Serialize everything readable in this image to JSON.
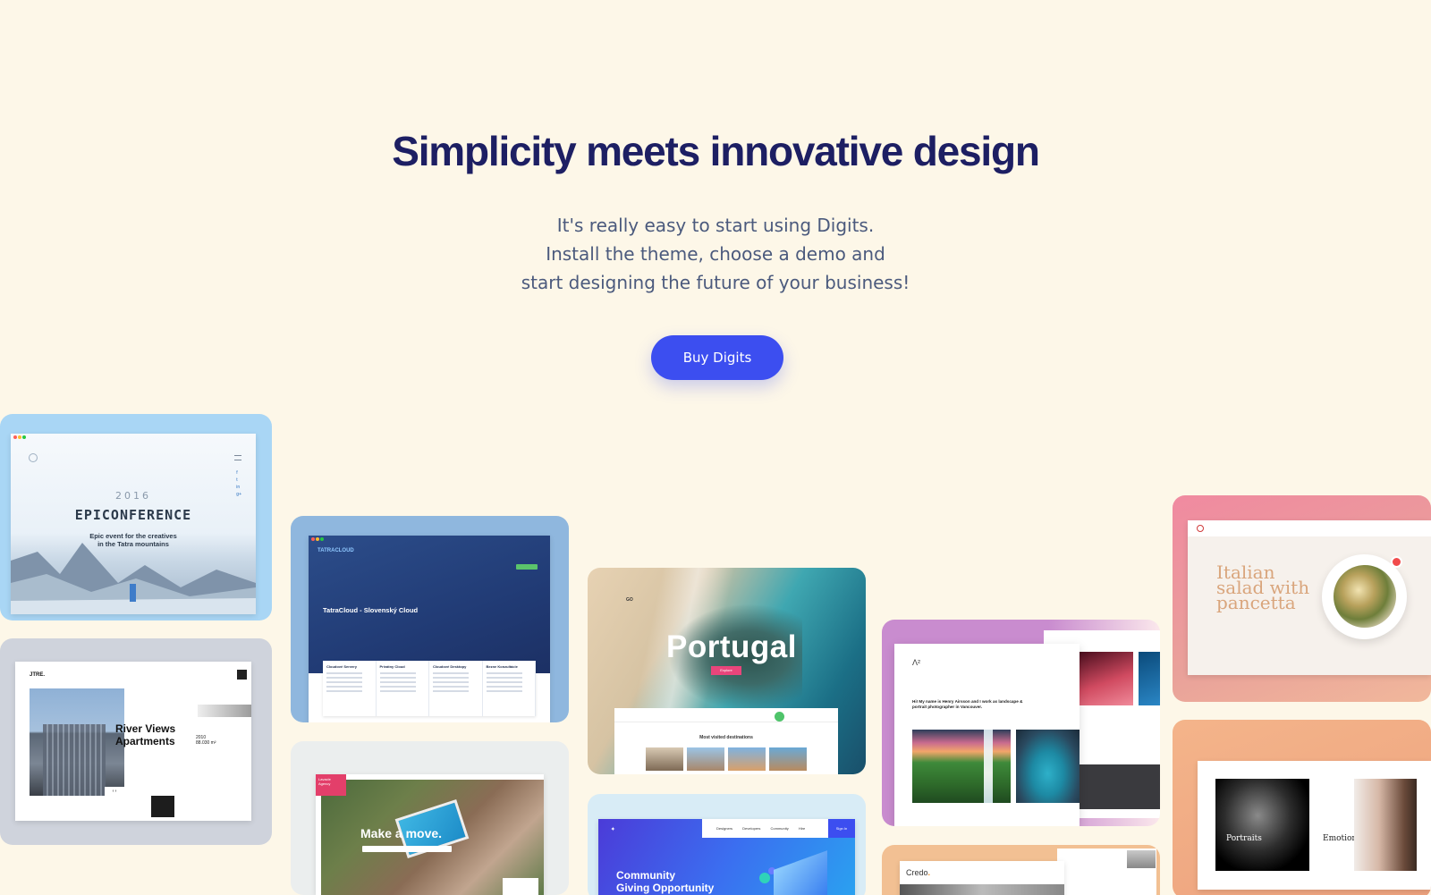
{
  "hero": {
    "title": "Simplicity meets innovative design",
    "subtitle_lines": [
      "It's really easy to start using Digits.",
      "Install the theme, choose a demo and",
      "start designing the future of your business!"
    ],
    "cta_label": "Buy Digits"
  },
  "colors": {
    "background": "#fdf7e8",
    "title": "#1d1f63",
    "subtitle": "#4b5a7d",
    "cta": "#3c4ef0"
  },
  "demos": {
    "epic": {
      "year": "2016",
      "name": "EPICONFERENCE",
      "tagline_lines": [
        "Epic event for the creatives",
        "in the Tatra mountains"
      ]
    },
    "tatra": {
      "logo": "TATRACLOUD",
      "headline": "TatraCloud - Slovenský Cloud",
      "columns": [
        "Cloudové Servery",
        "Privátny Cloud",
        "Cloudové Desktopy",
        "Bezne Konzultácie"
      ]
    },
    "portugal": {
      "logo": "GO",
      "title": "Portugal",
      "explore": "Explore",
      "most_visited": "Most visited destinations"
    },
    "photographer": {
      "intro": "Hi! My name is Henry Airsson and I work as landscape & portrait photographer in Vancouver."
    },
    "salad": {
      "headline": "Italian salad with pancetta"
    },
    "river": {
      "brand": "JTRE.",
      "headline_lines": [
        "River Views",
        "Apartments"
      ],
      "year": "2010",
      "area": "88.030 m²"
    },
    "move": {
      "tag": "Lavacle Agency",
      "headline": "Make a move."
    },
    "community": {
      "nav": [
        "Designers",
        "Developers",
        "Community",
        "Hire"
      ],
      "signin": "Sign In",
      "headline_lines": [
        "Community",
        "Giving Opportunity"
      ]
    },
    "credo": {
      "logo": "Credo",
      "logo_dot": "."
    },
    "portraits": {
      "left": "Portraits",
      "right": "Emotions"
    }
  }
}
